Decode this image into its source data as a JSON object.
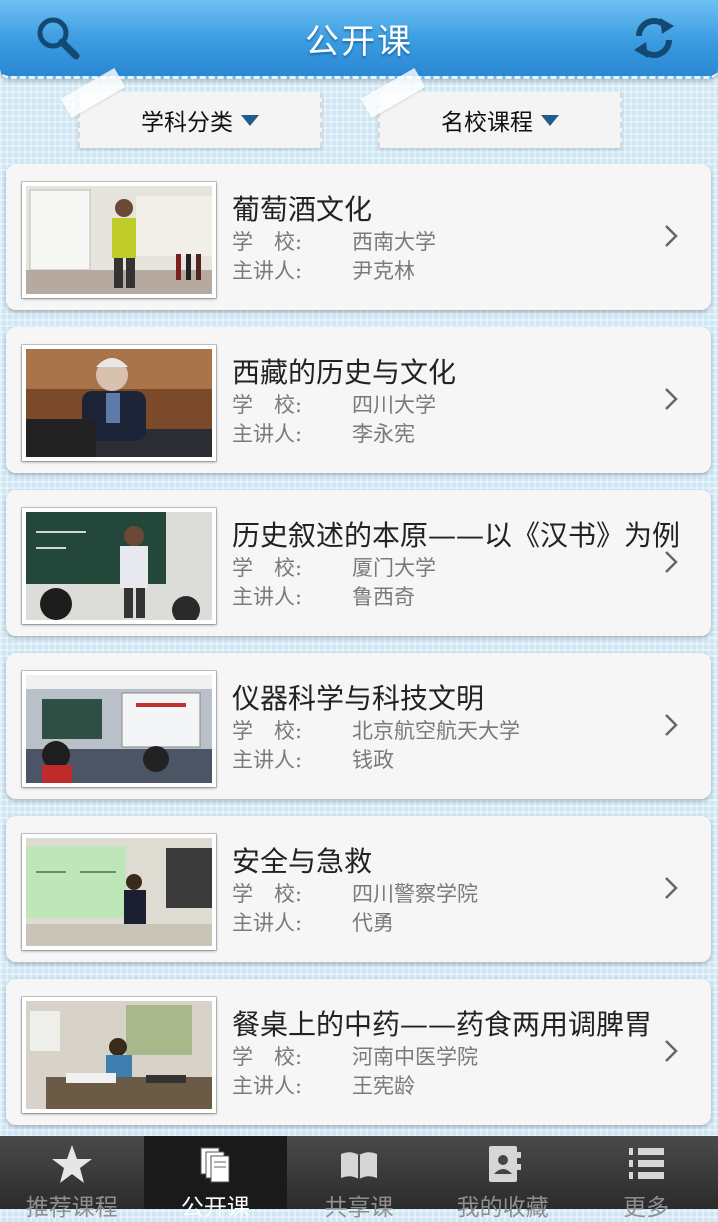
{
  "header": {
    "title": "公开课",
    "search_icon": "search-icon",
    "refresh_icon": "refresh-icon"
  },
  "filters": {
    "subject": "学科分类",
    "school": "名校课程"
  },
  "course_labels": {
    "school": "学　校:",
    "lecturer": "主讲人:"
  },
  "courses": [
    {
      "title": "葡萄酒文化",
      "school": "西南大学",
      "lecturer": "尹克林"
    },
    {
      "title": "西藏的历史与文化",
      "school": "四川大学",
      "lecturer": "李永宪"
    },
    {
      "title": "历史叙述的本原——以《汉书》为例",
      "school": "厦门大学",
      "lecturer": "鲁西奇"
    },
    {
      "title": "仪器科学与科技文明",
      "school": "北京航空航天大学",
      "lecturer": "钱政"
    },
    {
      "title": "安全与急救",
      "school": "四川警察学院",
      "lecturer": "代勇"
    },
    {
      "title": "餐桌上的中药——药食两用调脾胃",
      "school": "河南中医学院",
      "lecturer": "王宪龄"
    }
  ],
  "tabs": [
    {
      "label": "推荐课程",
      "icon": "star-icon"
    },
    {
      "label": "公开课",
      "icon": "books-icon"
    },
    {
      "label": "共享课",
      "icon": "open-book-icon"
    },
    {
      "label": "我的收藏",
      "icon": "contacts-icon"
    },
    {
      "label": "更多",
      "icon": "numbered-list-icon"
    }
  ],
  "active_tab": "公开课",
  "colors": {
    "header_blue": "#3a9be0",
    "tabbar": "#2b2b2b",
    "active_tab": "#1a1a1a"
  }
}
